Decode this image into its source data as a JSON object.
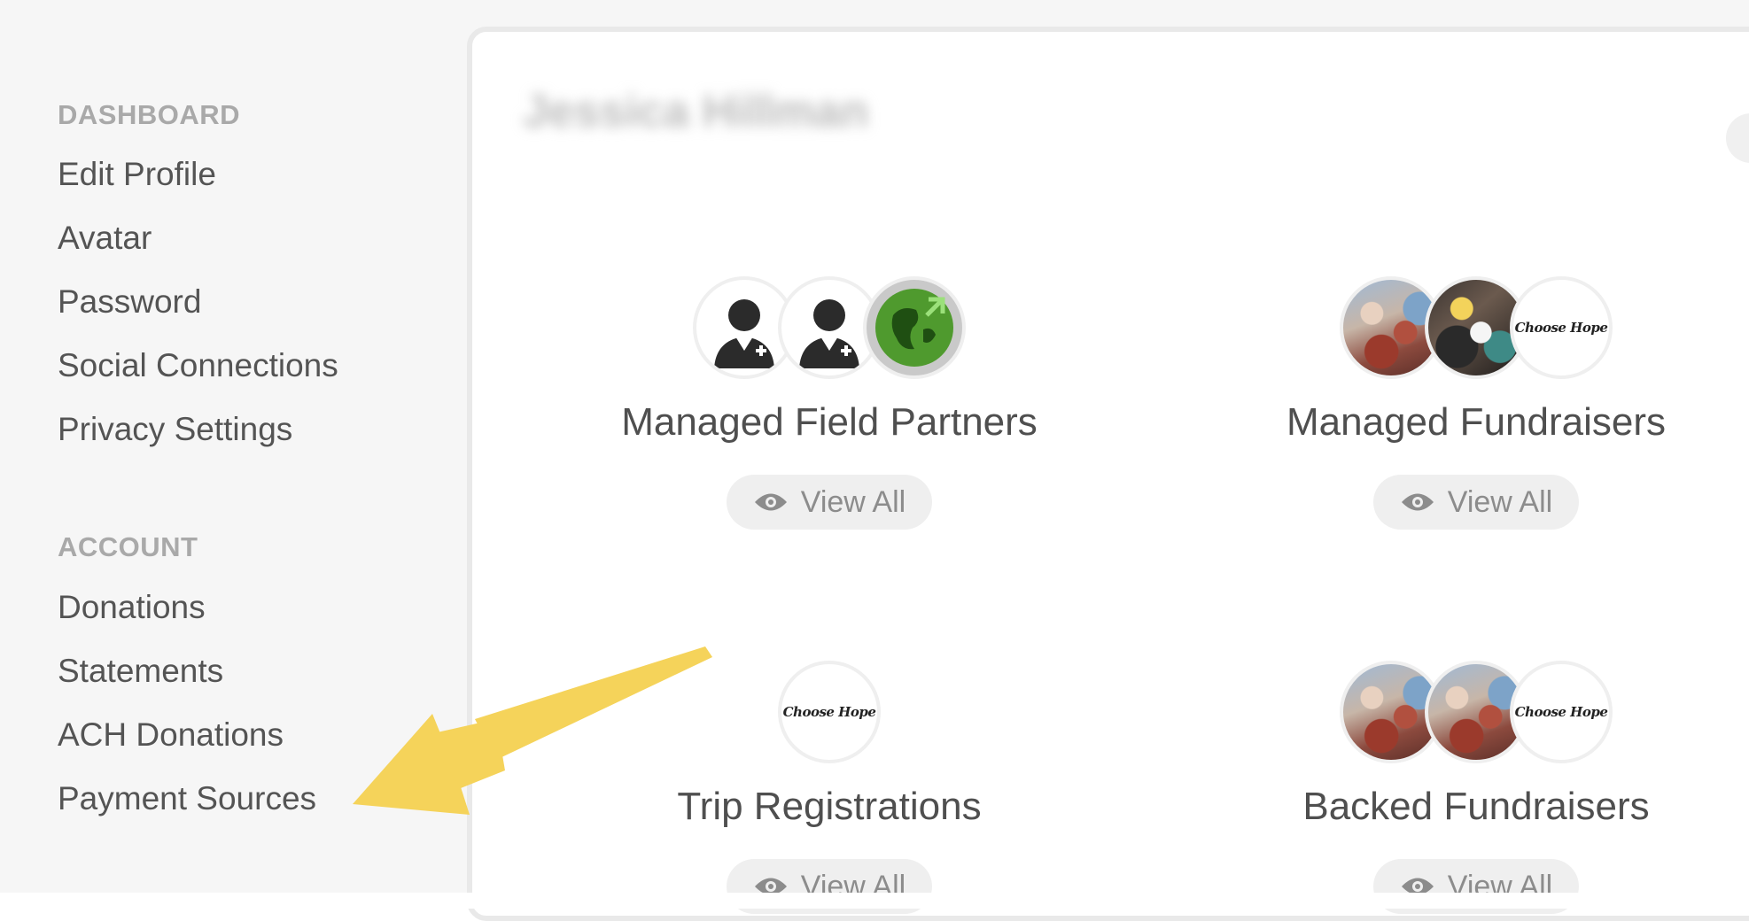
{
  "sidebar": {
    "dashboard_heading": "DASHBOARD",
    "dashboard_items": [
      {
        "label": "Edit Profile"
      },
      {
        "label": "Avatar"
      },
      {
        "label": "Password"
      },
      {
        "label": "Social Connections"
      },
      {
        "label": "Privacy Settings"
      }
    ],
    "account_heading": "ACCOUNT",
    "account_items": [
      {
        "label": "Donations"
      },
      {
        "label": "Statements"
      },
      {
        "label": "ACH Donations"
      },
      {
        "label": "Payment Sources"
      }
    ]
  },
  "main": {
    "user_name": "Jessica Hillman",
    "cards": [
      {
        "title": "Managed Field Partners",
        "button": "View All"
      },
      {
        "title": "Managed Fundraisers",
        "button": "View All"
      },
      {
        "title": "Trip Registrations",
        "button": "View All"
      },
      {
        "title": "Backed Fundraisers",
        "button": "View All"
      }
    ],
    "logo_text": "Choose Hope"
  },
  "colors": {
    "sidebar_bg": "#f6f6f6",
    "heading_gray": "#a9a9a9",
    "link_gray": "#545454",
    "arrow_yellow": "#f5d35a",
    "button_bg": "#efefef"
  },
  "icons": {
    "view_all": "eye-icon",
    "partner_avatar": "person-icon",
    "globe_avatar": "globe-icon"
  }
}
